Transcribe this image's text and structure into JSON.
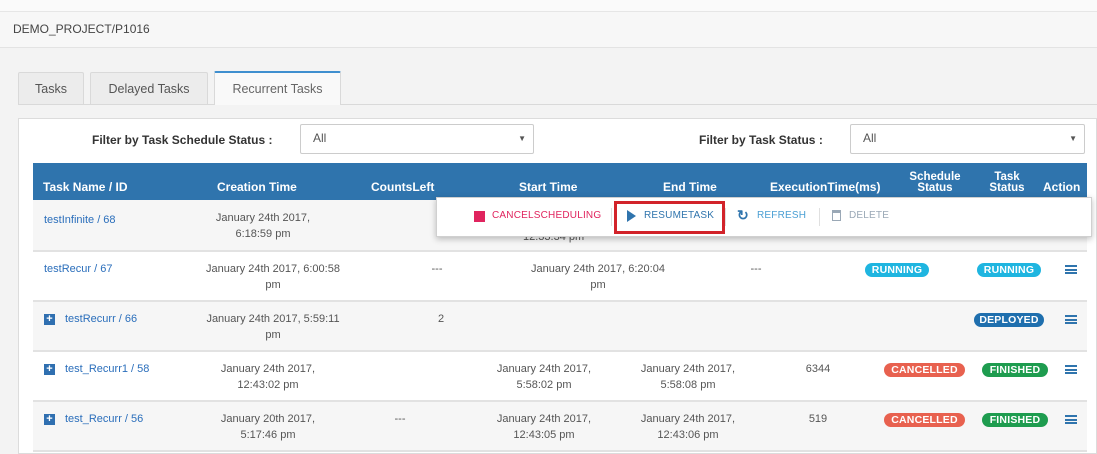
{
  "breadcrumb": "DEMO_PROJECT/P1016",
  "tabs": [
    {
      "label": "Tasks",
      "active": false
    },
    {
      "label": "Delayed Tasks",
      "active": false
    },
    {
      "label": "Recurrent Tasks",
      "active": true
    }
  ],
  "filters": {
    "schedule_status_label": "Filter by Task Schedule Status :",
    "schedule_status_value": "All",
    "task_status_label": "Filter by Task Status :",
    "task_status_value": "All"
  },
  "columns": {
    "name": "Task Name / ID",
    "creation": "Creation Time",
    "counts": "CountsLeft",
    "start": "Start Time",
    "end": "End Time",
    "exec": "ExecutionTime(ms)",
    "schedule_status_1": "Schedule",
    "schedule_status_2": "Status",
    "task_status_1": "Task",
    "task_status_2": "Status",
    "action": "Action"
  },
  "popup": {
    "cancel": "CANCELSCHEDULING",
    "resume": "RESUMETASK",
    "refresh": "REFRESH",
    "delete": "DELETE",
    "partial_start_time": "12:33:34 pm"
  },
  "rows": [
    {
      "name": "testInfinite / 68",
      "creation_1": "January 24th 2017,",
      "creation_2": "6:18:59 pm"
    },
    {
      "name": "testRecur / 67",
      "creation_1": "January 24th 2017, 6:00:58",
      "creation_2": "pm",
      "counts": "---",
      "start_1": "January 24th 2017, 6:20:04",
      "start_2": "pm",
      "exec": "---",
      "schedule_status": "RUNNING",
      "task_status": "RUNNING"
    },
    {
      "name": "testRecurr / 66",
      "creation_1": "January 24th 2017, 5:59:11",
      "creation_2": "pm",
      "counts": "2",
      "task_status": "DEPLOYED"
    },
    {
      "name": "test_Recurr1 / 58",
      "creation_1": "January 24th 2017,",
      "creation_2": "12:43:02 pm",
      "start_1": "January 24th 2017,",
      "start_2": "5:58:02 pm",
      "end_1": "January 24th 2017,",
      "end_2": "5:58:08 pm",
      "exec": "6344",
      "schedule_status": "CANCELLED",
      "task_status": "FINISHED"
    },
    {
      "name": "test_Recurr / 56",
      "creation_1": "January 20th 2017,",
      "creation_2": "5:17:46 pm",
      "counts": "---",
      "start_1": "January 24th 2017,",
      "start_2": "12:43:05 pm",
      "end_1": "January 24th 2017,",
      "end_2": "12:43:06 pm",
      "exec": "519",
      "schedule_status": "CANCELLED",
      "task_status": "FINISHED"
    }
  ],
  "colors": {
    "header": "#2f74ad",
    "running": "#1fb5e0",
    "deployed": "#1f6fae",
    "cancelled": "#e8614f",
    "finished": "#1e9c4f",
    "cancel_text": "#e0245e",
    "highlight": "#d2232a"
  }
}
